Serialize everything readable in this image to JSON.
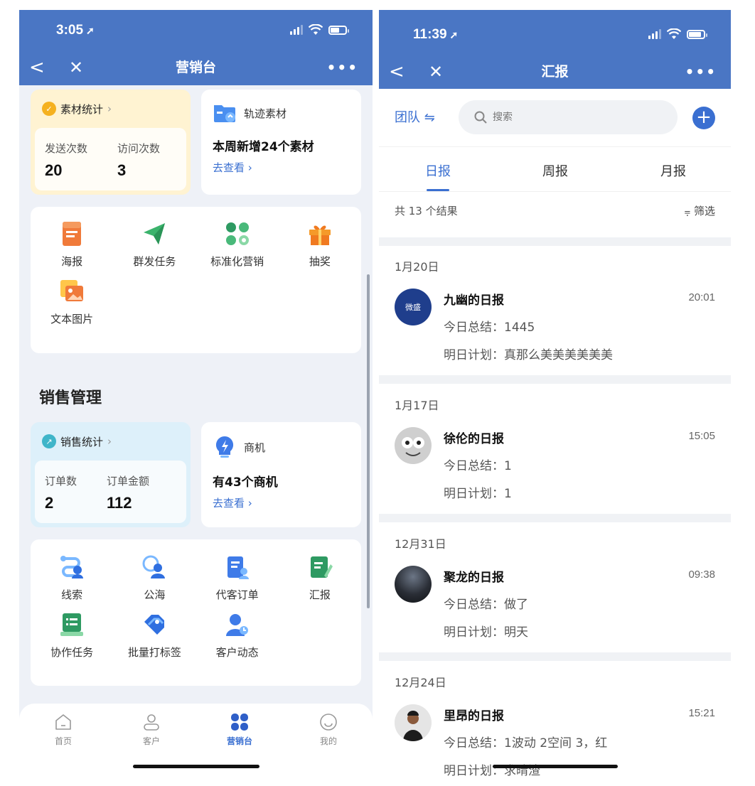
{
  "left": {
    "status": {
      "time": "3:05"
    },
    "nav": {
      "back": "<",
      "close": "✕",
      "title": "营销台",
      "more": "•••"
    },
    "material_stats": {
      "title": "素材统计",
      "send_label": "发送次数",
      "send_value": "20",
      "visit_label": "访问次数",
      "visit_value": "3"
    },
    "track": {
      "title": "轨迹素材",
      "main": "本周新增24个素材",
      "link": "去查看"
    },
    "marketing_tools": [
      {
        "label": "海报",
        "icon": "poster-icon"
      },
      {
        "label": "群发任务",
        "icon": "paper-plane-icon"
      },
      {
        "label": "标准化营销",
        "icon": "clover-icon"
      },
      {
        "label": "抽奖",
        "icon": "gift-icon"
      },
      {
        "label": "文本图片",
        "icon": "image-text-icon"
      }
    ],
    "section_title": "销售管理",
    "sales_stats": {
      "title": "销售统计",
      "orders_label": "订单数",
      "orders_value": "2",
      "amount_label": "订单金额",
      "amount_value": "112"
    },
    "opportunity": {
      "title": "商机",
      "main": "有43个商机",
      "link": "去查看"
    },
    "sales_tools": [
      {
        "label": "线索",
        "icon": "leads-icon"
      },
      {
        "label": "公海",
        "icon": "public-pool-icon"
      },
      {
        "label": "代客订单",
        "icon": "proxy-order-icon"
      },
      {
        "label": "汇报",
        "icon": "report-icon"
      },
      {
        "label": "协作任务",
        "icon": "collab-task-icon"
      },
      {
        "label": "批量打标签",
        "icon": "tag-icon"
      },
      {
        "label": "客户动态",
        "icon": "customer-activity-icon"
      }
    ],
    "tabbar": [
      {
        "label": "首页"
      },
      {
        "label": "客户"
      },
      {
        "label": "营销台"
      },
      {
        "label": "我的"
      }
    ]
  },
  "right": {
    "status": {
      "time": "11:39"
    },
    "nav": {
      "back": "<",
      "close": "✕",
      "title": "汇报",
      "more": "•••"
    },
    "team_label": "团队",
    "search": {
      "placeholder": "搜索"
    },
    "tabs": [
      "日报",
      "周报",
      "月报"
    ],
    "result_count": "共 13 个结果",
    "filter_label": "筛选",
    "groups": [
      {
        "date": "1月20日",
        "name": "九幽的日报",
        "time": "20:01",
        "summary": "今日总结：1445",
        "plan": "明日计划：真那么美美美美美美",
        "avatar_text": "微盛"
      },
      {
        "date": "1月17日",
        "name": "徐伦的日报",
        "time": "15:05",
        "summary": "今日总结：1",
        "plan": "明日计划：1"
      },
      {
        "date": "12月31日",
        "name": "聚龙的日报",
        "time": "09:38",
        "summary": "今日总结：做了",
        "plan": "明日计划：明天"
      },
      {
        "date": "12月24日",
        "name": "里昂的日报",
        "time": "15:21",
        "summary": "今日总结：1波动 2空间 3，红",
        "plan": "明日计划：求晴渣"
      }
    ]
  }
}
